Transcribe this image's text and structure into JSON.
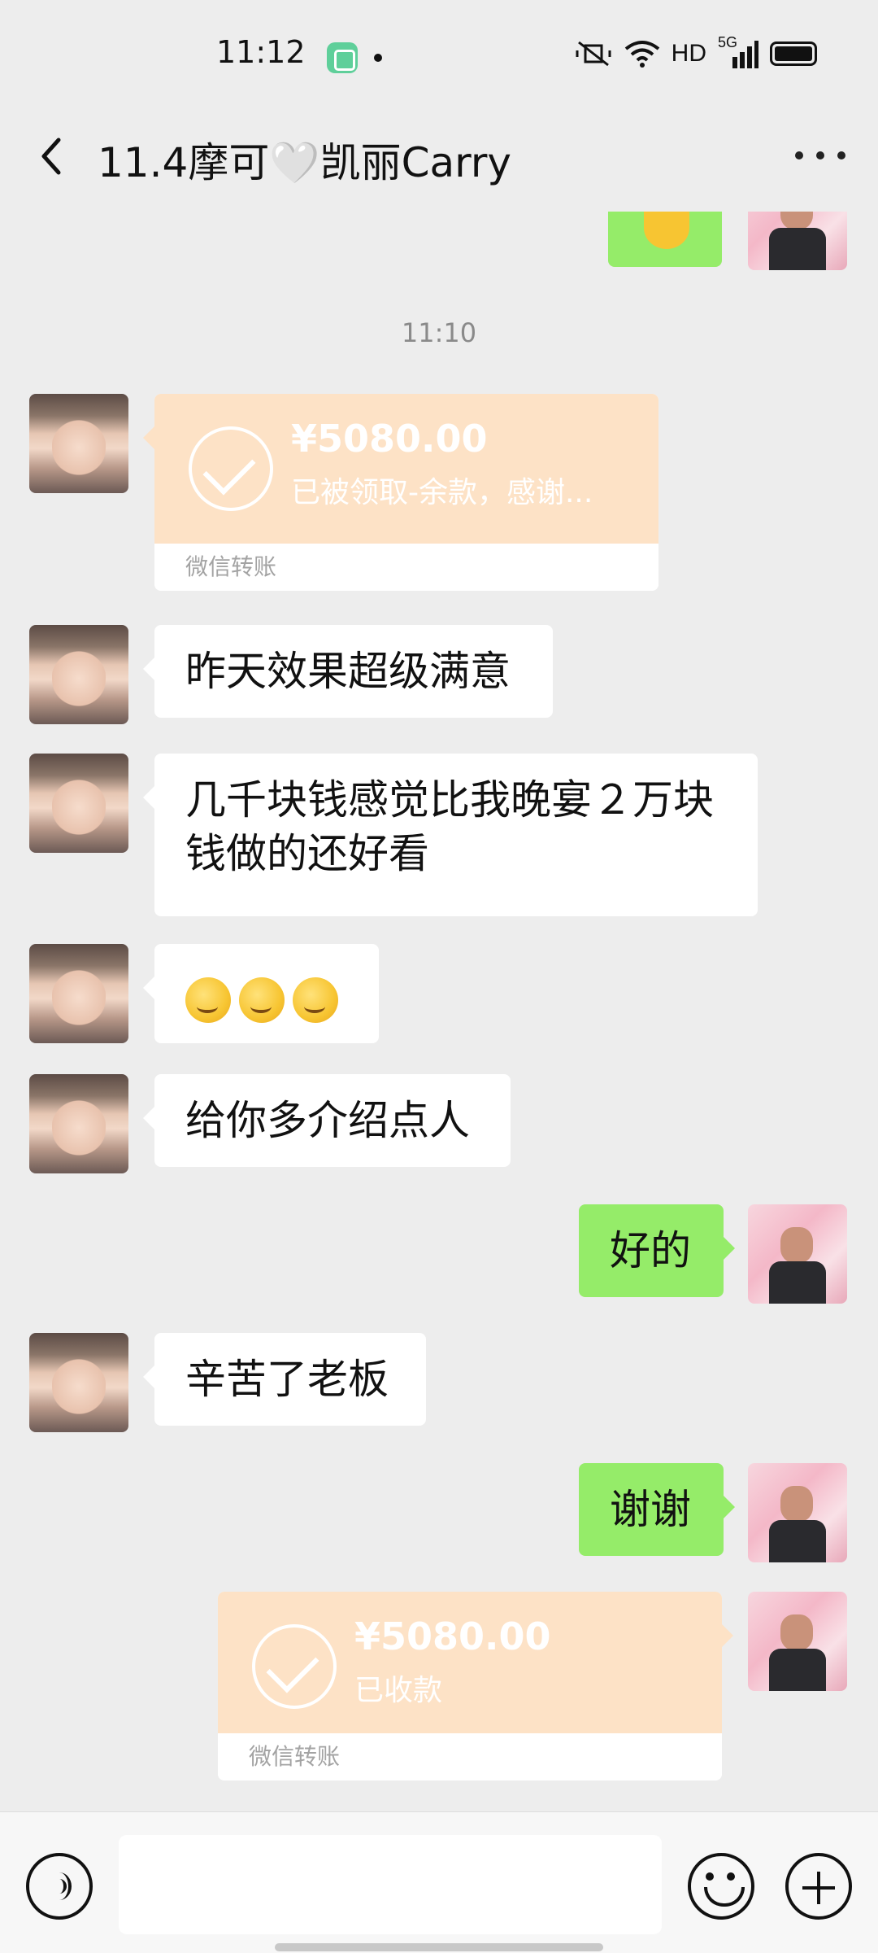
{
  "status_bar": {
    "time": "11:12",
    "network": "HD",
    "signal_label": "5G"
  },
  "header": {
    "title": "11.4摩可🤍凯丽Carry"
  },
  "chat": {
    "timestamp": "11:10",
    "transfer_received": {
      "amount": "¥5080.00",
      "note": "已被领取-余款，感谢...",
      "label": "微信转账"
    },
    "messages": [
      {
        "side": "left",
        "text": "昨天效果超级满意"
      },
      {
        "side": "left",
        "text": "几千块钱感觉比我晚宴２万块钱做的还好看"
      },
      {
        "side": "left",
        "emoji": [
          "hand-over-mouth-emoji",
          "hand-over-mouth-emoji",
          "hand-over-mouth-emoji"
        ]
      },
      {
        "side": "left",
        "text": "给你多介绍点人"
      },
      {
        "side": "right",
        "text": "好的"
      },
      {
        "side": "left",
        "text": "辛苦了老板"
      },
      {
        "side": "right",
        "text": "谢谢"
      }
    ],
    "transfer_sent": {
      "amount": "¥5080.00",
      "note": "已收款",
      "label": "微信转账"
    }
  },
  "input": {
    "value": "",
    "placeholder": ""
  },
  "colors": {
    "background": "#ededed",
    "outgoing_bubble": "#95ec69",
    "incoming_bubble": "#ffffff",
    "transfer_card": "#fde2c6"
  }
}
